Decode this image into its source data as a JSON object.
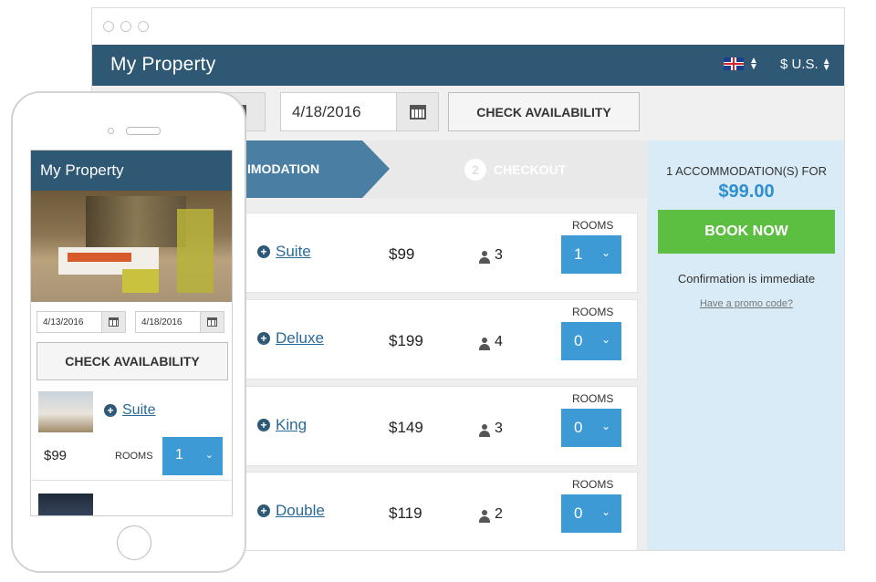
{
  "desktop": {
    "title": "My Property",
    "language_icon": "uk-flag-icon",
    "currency": "$ U.S.",
    "dates": {
      "checkin_visible": "",
      "checkout": "4/18/2016"
    },
    "check_availability_label": "CHECK AVAILABILITY",
    "steps": {
      "step1_label": "IMODATION",
      "step2_number": "2",
      "step2_label": "CHECKOUT"
    },
    "rooms": [
      {
        "name": "Suite",
        "price": "$99",
        "guests": "3",
        "rooms_label": "ROOMS",
        "selected": "1"
      },
      {
        "name": "Deluxe",
        "price": "$199",
        "guests": "4",
        "rooms_label": "ROOMS",
        "selected": "0"
      },
      {
        "name": "King",
        "price": "$149",
        "guests": "3",
        "rooms_label": "ROOMS",
        "selected": "0"
      },
      {
        "name": "Double",
        "price": "$119",
        "guests": "2",
        "rooms_label": "ROOMS",
        "selected": "0"
      }
    ],
    "summary": {
      "for_text": "1 ACCOMMODATION(S) FOR",
      "total": "$99.00",
      "book_label": "BOOK NOW",
      "confirm_text": "Confirmation is immediate",
      "promo_text": "Have a promo code?"
    }
  },
  "mobile": {
    "title": "My Property",
    "checkin": "4/13/2016",
    "checkout": "4/18/2016",
    "check_availability_label": "CHECK AVAILABILITY",
    "room": {
      "name": "Suite",
      "price": "$99",
      "rooms_label": "ROOMS",
      "selected": "1"
    }
  },
  "colors": {
    "header": "#2e5874",
    "step_active": "#4a7fa3",
    "select_blue": "#3d9ad5",
    "book_green": "#5cbf42",
    "summary_bg": "#d9ebf6",
    "link": "#2a6a97"
  }
}
